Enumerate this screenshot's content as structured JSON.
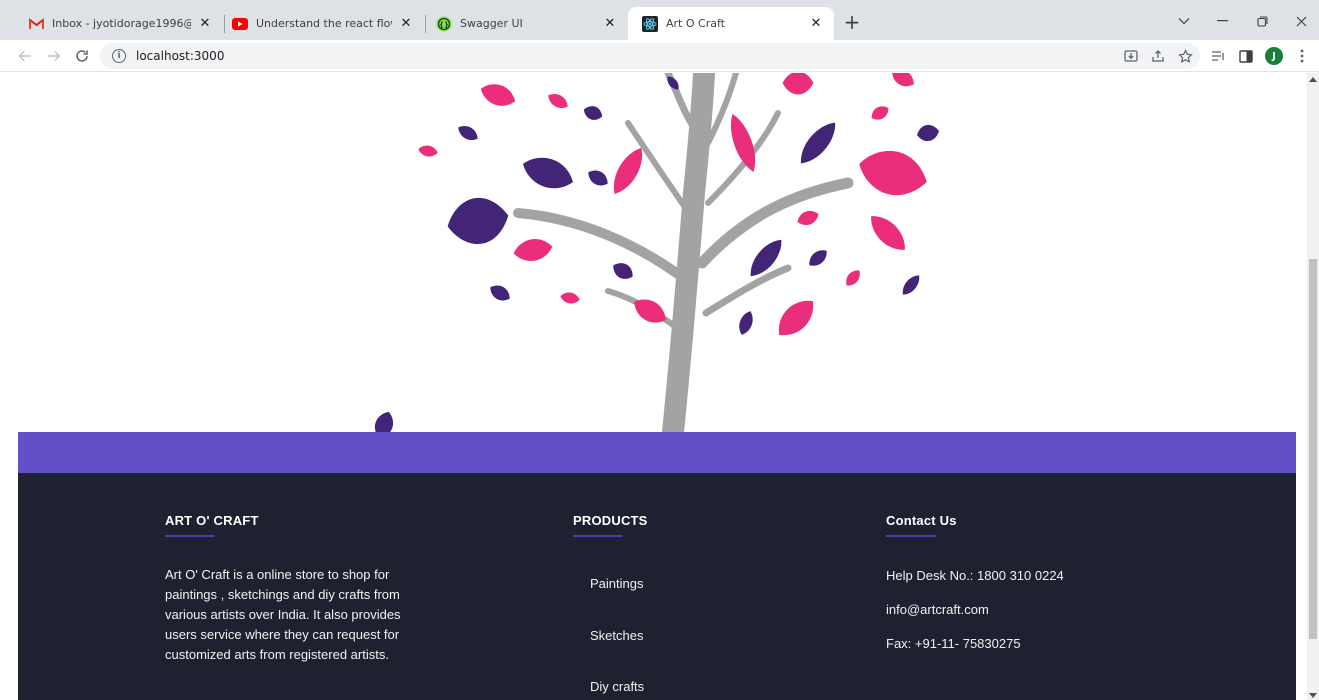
{
  "browser": {
    "tabs": [
      {
        "title": "Inbox - jyotidorage1996@gmail.c",
        "icon": "gmail-icon",
        "active": false
      },
      {
        "title": "Understand the react flow and st",
        "icon": "youtube-icon",
        "active": false
      },
      {
        "title": "Swagger UI",
        "icon": "swagger-icon",
        "active": false
      },
      {
        "title": "Art O Craft",
        "icon": "react-icon",
        "active": true
      }
    ],
    "close_glyph": "✕",
    "new_tab_glyph": "+",
    "address": "localhost:3000",
    "avatar_initial": "J"
  },
  "footer": {
    "brand": {
      "heading": "ART O' CRAFT",
      "about": "Art O' Craft is a online store to shop for paintings , sketchings and diy crafts from various artists over India. It also provides users service where they can request for customized arts from registered artists."
    },
    "products": {
      "heading": "PRODUCTS",
      "items": [
        "Paintings",
        "Sketches",
        "Diy crafts"
      ]
    },
    "contact": {
      "heading": "Contact Us",
      "helpdesk": "Help Desk No.: 1800 310 0224",
      "email": "info@artcraft.com",
      "fax": "Fax: +91-11- 75830275"
    }
  },
  "colors": {
    "accent_purple": "#6350c8",
    "footer_bg": "#1e2130",
    "leaf_pink": "#ea2e7b",
    "leaf_purple": "#432577",
    "trunk_gray": "#a3a3a3"
  }
}
